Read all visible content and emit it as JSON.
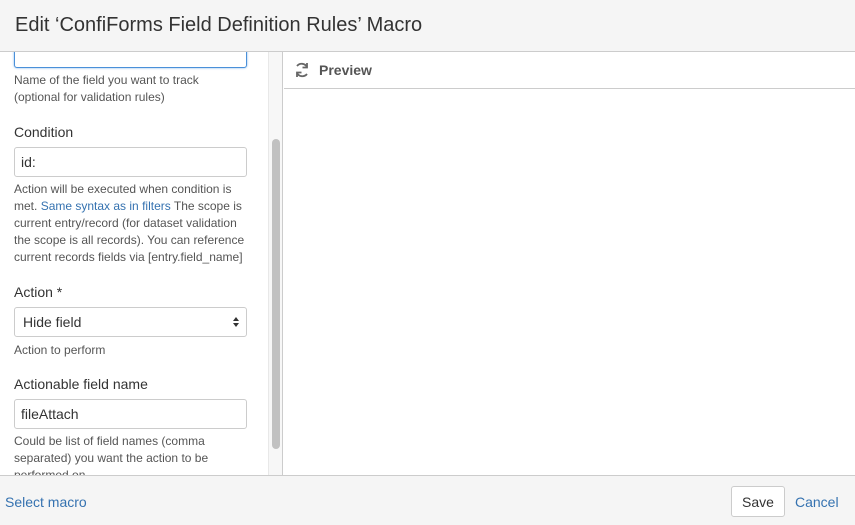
{
  "dialog": {
    "title": "Edit ‘ConfiForms Field Definition Rules’ Macro"
  },
  "form": {
    "field_name_input": {
      "value": ""
    },
    "field_name_help": [
      "Name of the field you want to track",
      "(optional for validation rules)"
    ],
    "condition": {
      "label": "Condition",
      "value": "id:",
      "help_line1": "Action will be executed when condition is",
      "help_line2_prefix": "met.",
      "help_link": "Same syntax as in filters",
      "help_line2_suffix": "The scope is",
      "help_line3": "current entry/record (for dataset validation",
      "help_line4": "the scope is all records). You can reference",
      "help_line5": "current records fields via [entry.field_name]"
    },
    "action": {
      "label": "Action *",
      "selected": "Hide field",
      "help": "Action to perform"
    },
    "actionable_field": {
      "label": "Actionable field name",
      "value": "fileAttach",
      "help_line1": "Could be list of field names (comma",
      "help_line2": "separated) you want the action to be",
      "help_line3": "performed on"
    }
  },
  "preview": {
    "label": "Preview",
    "icon": "refresh-icon"
  },
  "footer": {
    "select_macro": "Select macro",
    "save": "Save",
    "cancel": "Cancel"
  },
  "colors": {
    "link": "#3572b0",
    "focus": "#4a90d9"
  }
}
